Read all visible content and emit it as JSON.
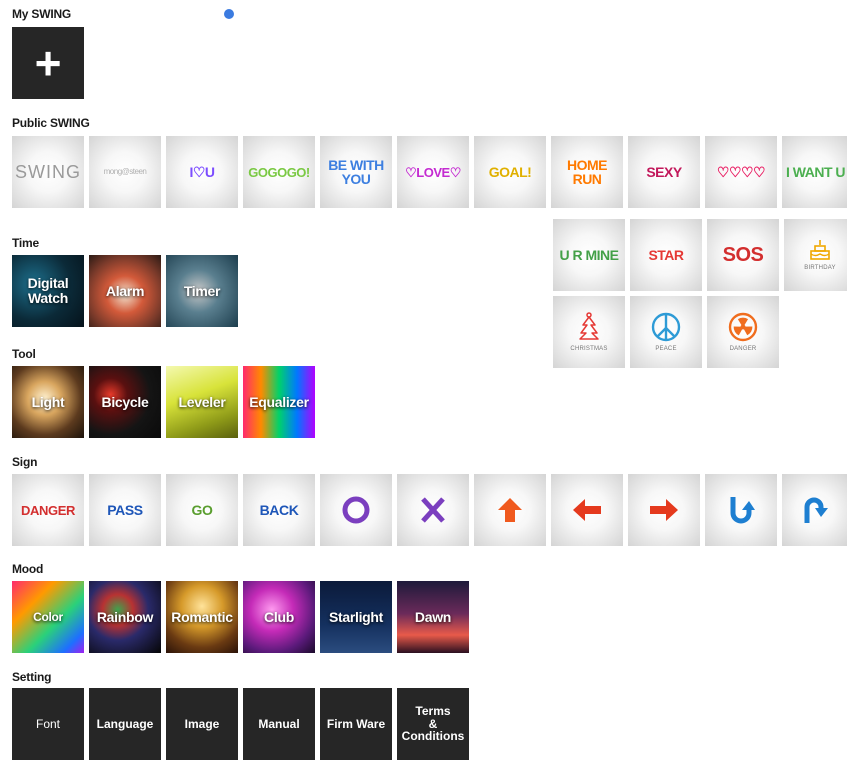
{
  "sections": {
    "my_swing": "My SWING",
    "public_swing": "Public SWING",
    "time": "Time",
    "tool": "Tool",
    "sign": "Sign",
    "mood": "Mood",
    "setting": "Setting"
  },
  "my_swing": {
    "add_icon": "plus-icon",
    "add_glyph": "+"
  },
  "public_swing": [
    {
      "label": "SWING",
      "color": "#9a9a9a"
    },
    {
      "label": "mong@steen",
      "color": "#b0b0b0"
    },
    {
      "label": "I♡U",
      "color": "#7c4dff"
    },
    {
      "label": "GOGOGO!",
      "color": "#7ac943"
    },
    {
      "label_line1": "BE WITH",
      "label_line2": "YOU",
      "color": "#3d7fe0"
    },
    {
      "label": "♡LOVE♡",
      "color": "#c42bd1"
    },
    {
      "label": "GOAL!",
      "color": "#e0b000"
    },
    {
      "label_line1": "HOME",
      "label_line2": "RUN",
      "color": "#ff7a00"
    },
    {
      "label": "SEXY",
      "color": "#c2185b"
    },
    {
      "label": "♡♡♡♡",
      "color": "#e91e63"
    },
    {
      "label": "I WANT U",
      "color": "#4caf50"
    },
    {
      "label": "U R MINE",
      "color": "#43a047"
    },
    {
      "label": "STAR",
      "color": "#e53935"
    },
    {
      "label": "SOS",
      "color": "#d32f2f"
    },
    {
      "label": "BIRTHDAY",
      "icon": "birthday-cake-icon",
      "color": "#f0a800"
    },
    {
      "label": "CHRISTMAS",
      "icon": "christmas-tree-icon",
      "color": "#e53935"
    },
    {
      "label": "PEACE",
      "icon": "peace-icon",
      "color": "#2e9bd6"
    },
    {
      "label": "DANGER",
      "icon": "radiation-icon",
      "color": "#f06d1e"
    }
  ],
  "time": [
    {
      "label_line1": "Digital",
      "label_line2": "Watch"
    },
    {
      "label": "Alarm"
    },
    {
      "label": "Timer"
    }
  ],
  "tool": [
    {
      "label": "Light"
    },
    {
      "label": "Bicycle"
    },
    {
      "label": "Leveler"
    },
    {
      "label": "Equalizer"
    }
  ],
  "sign": [
    {
      "label": "DANGER",
      "color": "#d32f2f"
    },
    {
      "label": "PASS",
      "color": "#1e56b8"
    },
    {
      "label": "GO",
      "color": "#5a9e2f"
    },
    {
      "label": "BACK",
      "color": "#1e56b8"
    },
    {
      "icon": "circle-icon",
      "color": "#7b3fbf"
    },
    {
      "icon": "x-icon",
      "color": "#7b3fbf"
    },
    {
      "icon": "arrow-up-icon",
      "color": "#f05a1e"
    },
    {
      "icon": "arrow-left-icon",
      "color": "#e53a1e"
    },
    {
      "icon": "arrow-right-icon",
      "color": "#e53a1e"
    },
    {
      "icon": "u-turn-down-icon",
      "color": "#1e7fd1"
    },
    {
      "icon": "u-turn-right-icon",
      "color": "#1e7fd1"
    }
  ],
  "mood": [
    {
      "label": "Color"
    },
    {
      "label": "Rainbow"
    },
    {
      "label": "Romantic"
    },
    {
      "label": "Club"
    },
    {
      "label": "Starlight"
    },
    {
      "label": "Dawn"
    }
  ],
  "setting": [
    {
      "label": "Font"
    },
    {
      "label": "Language"
    },
    {
      "label": "Image"
    },
    {
      "label": "Manual"
    },
    {
      "label": "Firm Ware"
    },
    {
      "label_line1": "Terms",
      "label_line2": "&",
      "label_line3": "Conditions"
    }
  ],
  "colors": {
    "accent_dot": "#3b7be0",
    "dark_tile": "#262626"
  }
}
